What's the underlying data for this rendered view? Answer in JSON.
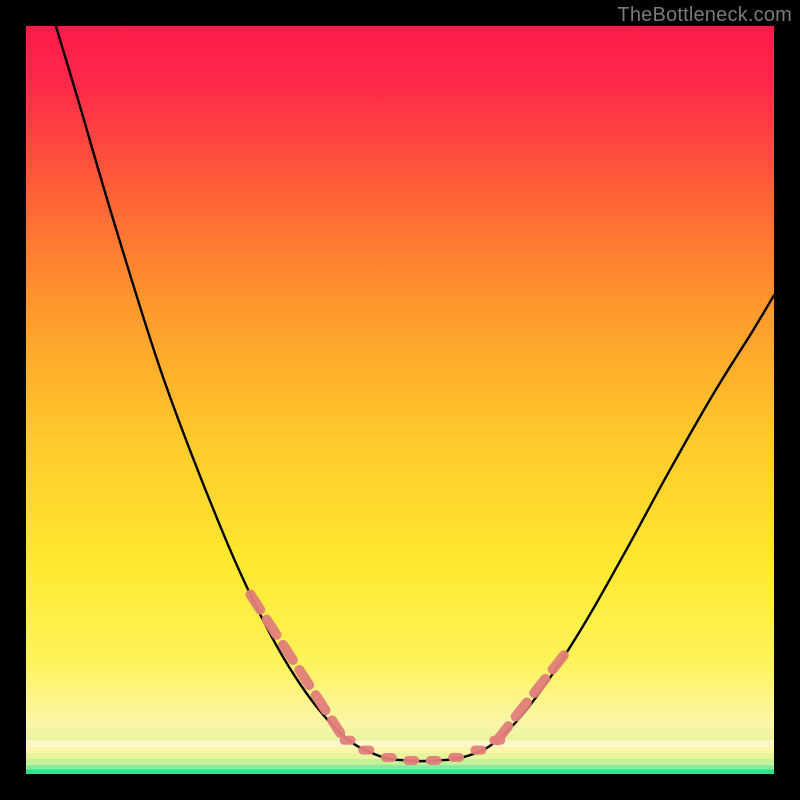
{
  "watermark": "TheBottleneck.com",
  "chart_data": {
    "type": "line",
    "title": "",
    "xlabel": "",
    "ylabel": "",
    "xlim": [
      0,
      100
    ],
    "ylim": [
      0,
      100
    ],
    "grid": false,
    "legend": false,
    "background_gradient": {
      "top": "#ff1a4b",
      "upper_mid": "#ff8a2a",
      "mid": "#ffe92f",
      "lower_mid": "#fdf7a8",
      "bottom": "#1fe28a"
    },
    "bottom_bands": [
      {
        "y": 95.5,
        "color": "#fff7c8"
      },
      {
        "y": 96.4,
        "color": "#fcf5a8"
      },
      {
        "y": 97.2,
        "color": "#e8f59a"
      },
      {
        "y": 98.0,
        "color": "#c5f09a"
      },
      {
        "y": 98.8,
        "color": "#86eaa0"
      },
      {
        "y": 99.4,
        "color": "#2fe38d"
      }
    ],
    "curve_points": [
      {
        "x": 4.0,
        "y": 0.0
      },
      {
        "x": 7.0,
        "y": 10.0
      },
      {
        "x": 12.0,
        "y": 27.0
      },
      {
        "x": 18.0,
        "y": 46.0
      },
      {
        "x": 24.0,
        "y": 62.0
      },
      {
        "x": 30.0,
        "y": 76.0
      },
      {
        "x": 36.0,
        "y": 87.0
      },
      {
        "x": 42.0,
        "y": 94.5
      },
      {
        "x": 47.0,
        "y": 97.5
      },
      {
        "x": 51.0,
        "y": 98.2
      },
      {
        "x": 55.0,
        "y": 98.2
      },
      {
        "x": 59.0,
        "y": 97.6
      },
      {
        "x": 63.0,
        "y": 95.5
      },
      {
        "x": 68.0,
        "y": 90.0
      },
      {
        "x": 74.0,
        "y": 81.0
      },
      {
        "x": 80.0,
        "y": 70.5
      },
      {
        "x": 86.0,
        "y": 59.5
      },
      {
        "x": 92.0,
        "y": 49.0
      },
      {
        "x": 97.0,
        "y": 41.0
      },
      {
        "x": 100.0,
        "y": 36.0
      }
    ],
    "dash_segments": [
      {
        "start": {
          "x": 30.0,
          "y": 76.0
        },
        "end": {
          "x": 42.0,
          "y": 94.5
        },
        "color": "#e27f7b"
      },
      {
        "start": {
          "x": 63.0,
          "y": 95.5
        },
        "end": {
          "x": 72.0,
          "y": 84.0
        },
        "color": "#e27f7b"
      }
    ],
    "bottom_markers": [
      {
        "x": 43.0,
        "y": 95.5
      },
      {
        "x": 45.5,
        "y": 96.8
      },
      {
        "x": 48.5,
        "y": 97.8
      },
      {
        "x": 51.5,
        "y": 98.2
      },
      {
        "x": 54.5,
        "y": 98.2
      },
      {
        "x": 57.5,
        "y": 97.8
      },
      {
        "x": 60.5,
        "y": 96.8
      },
      {
        "x": 63.0,
        "y": 95.5
      }
    ],
    "marker_color": "#e27f7b"
  }
}
